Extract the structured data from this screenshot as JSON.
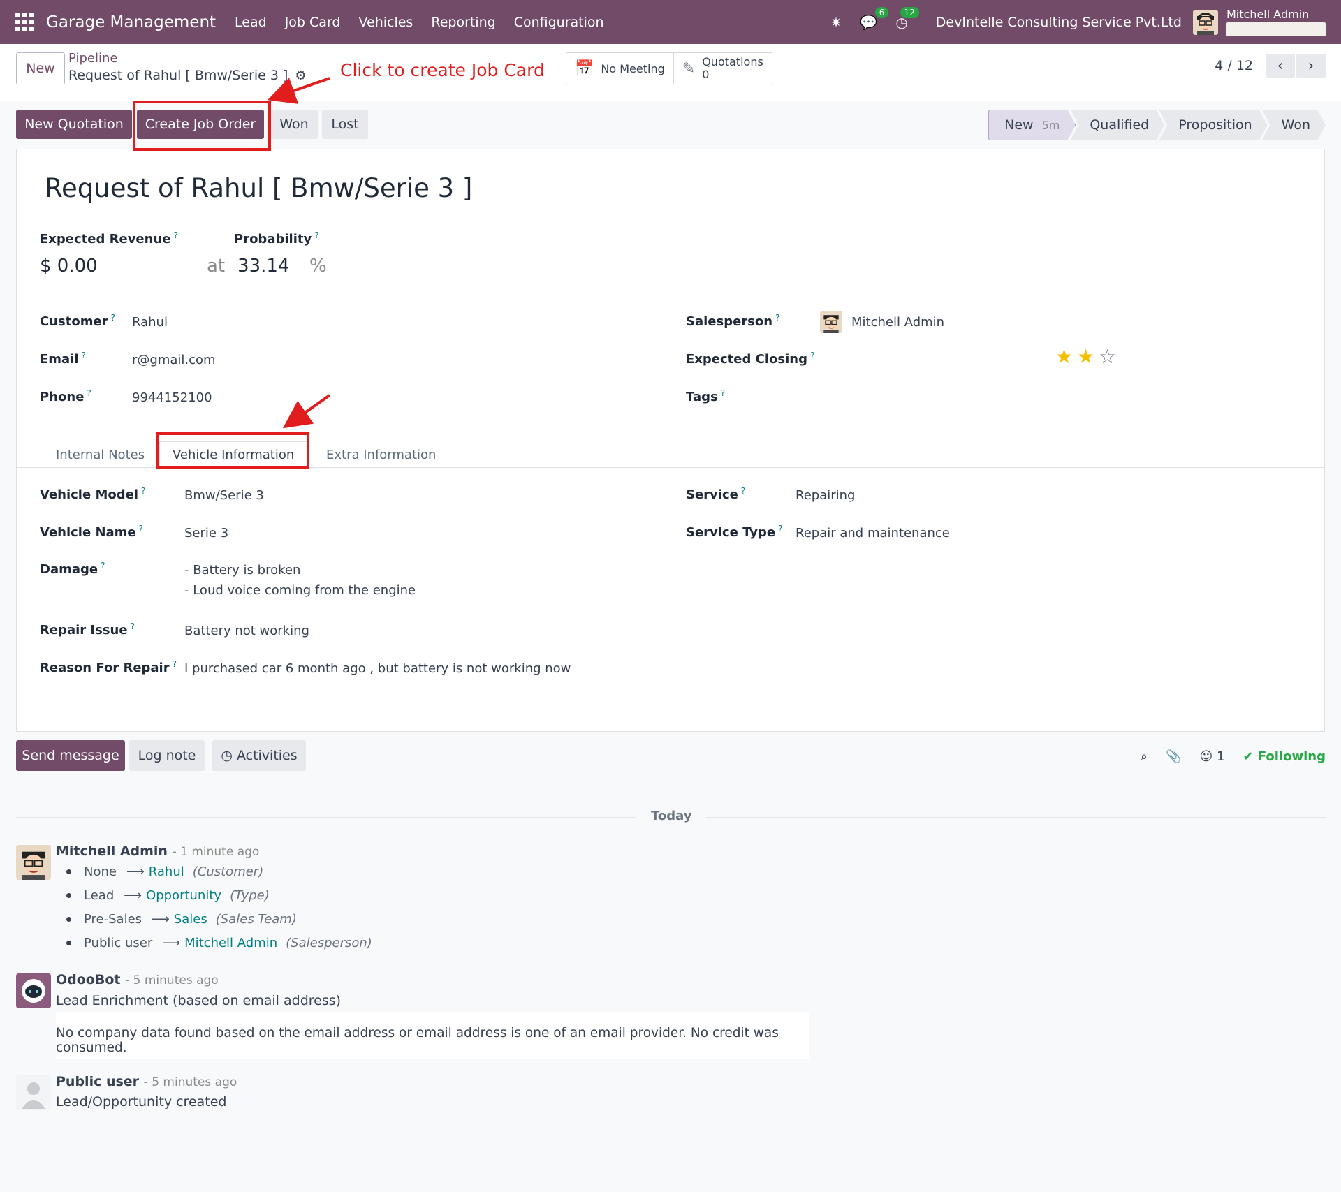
{
  "navbar": {
    "app_title": "Garage Management",
    "menu": [
      "Lead",
      "Job Card",
      "Vehicles",
      "Reporting",
      "Configuration"
    ],
    "messages_count": "6",
    "activities_count": "12",
    "company": "DevIntelle Consulting Service Pvt.Ltd",
    "user_name": "Mitchell Admin",
    "color_bg": "#714b67"
  },
  "control": {
    "new_label": "New",
    "breadcrumb_parent": "Pipeline",
    "breadcrumb_current": "Request of Rahul [ Bmw/Serie 3 ]",
    "no_meeting": "No Meeting",
    "quotations_label": "Quotations",
    "quotations_count": "0",
    "pager": "4 / 12"
  },
  "actions": {
    "new_quotation": "New Quotation",
    "create_job_order": "Create Job Order",
    "won": "Won",
    "lost": "Lost"
  },
  "stages": [
    {
      "label": "New",
      "duration": "5m"
    },
    {
      "label": "Qualified"
    },
    {
      "label": "Proposition"
    },
    {
      "label": "Won"
    }
  ],
  "annotations": {
    "create_job_card": "Click to create Job Card"
  },
  "form": {
    "title": "Request of Rahul [ Bmw/Serie 3 ]",
    "expected_revenue_label": "Expected Revenue",
    "expected_revenue": "$ 0.00",
    "probability_label": "Probability",
    "at": "at",
    "probability": "33.14",
    "percent": "%",
    "customer_label": "Customer",
    "customer": "Rahul",
    "email_label": "Email",
    "email": "r@gmail.com",
    "phone_label": "Phone",
    "phone": "9944152100",
    "salesperson_label": "Salesperson",
    "salesperson": "Mitchell Admin",
    "expected_closing_label": "Expected Closing",
    "priority_stars": 2,
    "tags_label": "Tags",
    "help_mark": "?"
  },
  "tabs": [
    "Internal Notes",
    "Vehicle Information",
    "Extra Information"
  ],
  "vehicle": {
    "model_label": "Vehicle Model",
    "model": "Bmw/Serie 3",
    "name_label": "Vehicle Name",
    "name": "Serie 3",
    "damage_label": "Damage",
    "damage_lines": [
      "- Battery is broken",
      "- Loud voice coming from the engine"
    ],
    "repair_issue_label": "Repair Issue",
    "repair_issue": "Battery not working",
    "reason_label": "Reason For Repair",
    "reason": "I purchased car 6 month ago , but battery is not working now",
    "service_label": "Service",
    "service": "Repairing",
    "service_type_label": "Service Type",
    "service_type": "Repair and maintenance"
  },
  "chatter": {
    "send_message": "Send message",
    "log_note": "Log note",
    "activities": "Activities",
    "followers": "1",
    "following": "Following",
    "today": "Today",
    "messages": [
      {
        "author": "Mitchell Admin",
        "ago": "- 1 minute ago",
        "tracking": [
          {
            "old": "None",
            "new": "Rahul",
            "field": "(Customer)"
          },
          {
            "old": "Lead",
            "new": "Opportunity",
            "field": "(Type)"
          },
          {
            "old": "Pre-Sales",
            "new": "Sales",
            "field": "(Sales Team)"
          },
          {
            "old": "Public user",
            "new": "Mitchell Admin",
            "field": "(Salesperson)"
          }
        ]
      },
      {
        "author": "OdooBot",
        "ago": "- 5 minutes ago",
        "body": "Lead Enrichment (based on email address)",
        "note": "No company data found based on the email address or email address is one of an email provider. No credit was consumed."
      },
      {
        "author": "Public user",
        "ago": "- 5 minutes ago",
        "body": "Lead/Opportunity created"
      }
    ]
  }
}
